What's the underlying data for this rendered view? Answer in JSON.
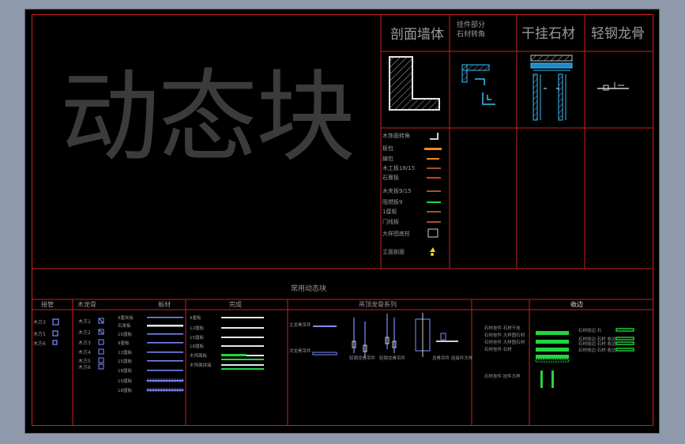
{
  "title_big": "动态块",
  "headers": {
    "section_wall": "剖面墙体",
    "stone_corner_line1": "挂件部分",
    "stone_corner_line2": "石材转角",
    "dry_hang_stone": "干挂石材",
    "light_steel_keel": "轻钢龙骨"
  },
  "legend_items": [
    "木饰面转角",
    "板包",
    "線包",
    "木工板18/15",
    "石膏板",
    "木夹板9/15",
    "阻燃板9",
    "1厘板",
    "门线板",
    "大样图底柱",
    "立面剖面"
  ],
  "bottom_title": "常用动态块",
  "bottom_headers": {
    "fixtures": "接管",
    "wood_keel": "木龙骨",
    "board": "板材",
    "finish": "完成",
    "ceiling_keel": "吊顶龙骨系列",
    "edge": "收边"
  },
  "fixture_items": [
    "木方3",
    "木方5",
    "木方6"
  ],
  "wood_keel_items": [
    "木方1",
    "木方2",
    "木方3",
    "木方4",
    "木方5",
    "木方6"
  ],
  "board_items": [
    "9厘夹板",
    "石膏板",
    "15厘板",
    "9厘板",
    "12厘板",
    "15厘板",
    "18厘板",
    "15厘板",
    "18厘板"
  ],
  "finish_items": [
    "9厘板",
    "12厘板",
    "15厘板",
    "18厘板",
    "木饰面板",
    "木饰面拼接"
  ],
  "ceiling_items": [
    "主龙骨吊件",
    "次龙骨吊件"
  ],
  "ceiling_captions": [
    "轻钢龙骨吊件",
    "轻钢龙骨吊件",
    "龙骨吊件 连接件大样"
  ],
  "stone_items": [
    "石材挂件 石材干挂",
    "石材挂件 大样图石材",
    "石材挂件 大样图石材",
    "石材挂件 石材",
    "石材挂件 挂件大样"
  ],
  "edge_items": [
    "石材收边 石",
    "石材收边 石材 收边",
    "石材收边 石材 收边",
    "石材收边 石材 收边"
  ],
  "colors": {
    "border": "#cc1f1f",
    "label": "#9a9a9a",
    "blue": "#7f8fff",
    "cyan": "#36c2f4",
    "green": "#22d640",
    "orange": "#f28a1a",
    "brown": "#a0522d",
    "big_text": "#3b3b3b"
  }
}
